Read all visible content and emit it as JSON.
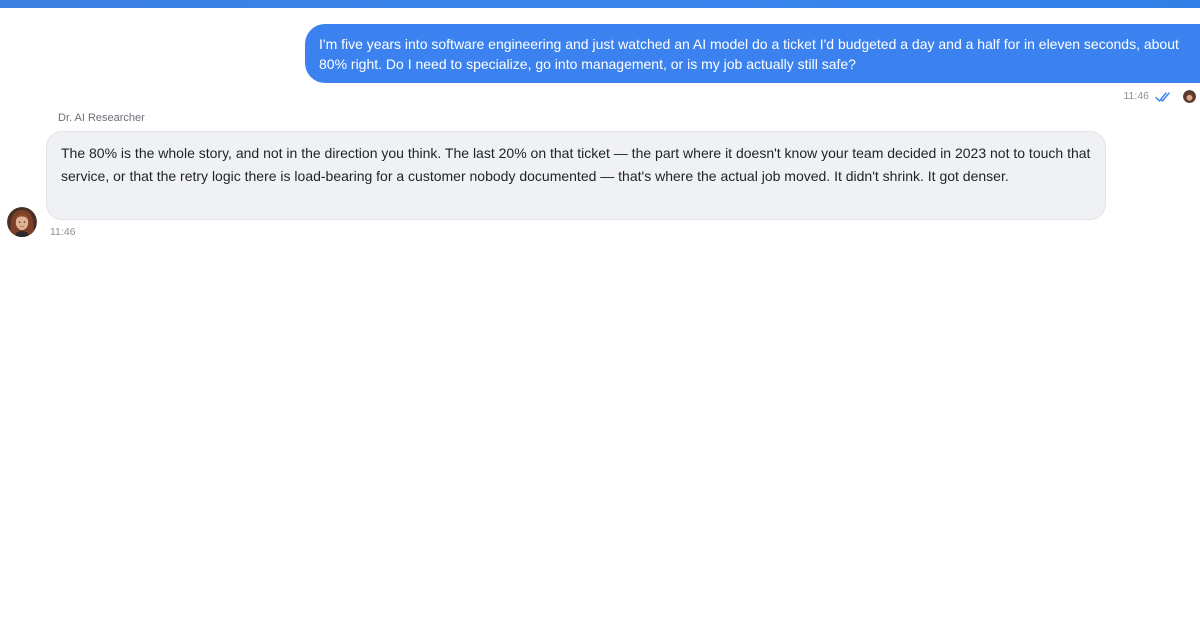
{
  "conversation": {
    "outgoing": {
      "text": "I'm five years into software engineering and just watched an AI model do a ticket I'd budgeted a day and a half for in eleven seconds, about 80% right. Do I need to specialize, go into management, or is my job actually still safe?",
      "time": "11:46",
      "status": "read",
      "bubble_color": "#3b82f0"
    },
    "incoming": {
      "sender": "Dr. AI Researcher",
      "text": "The 80% is the whole story, and not in the direction you think. The last 20% on that ticket — the part where it doesn't know your team decided in 2023 not to touch that service, or that the retry logic there is load-bearing for a customer nobody documented — that's where the actual job moved. It didn't shrink. It got denser.",
      "time": "11:46",
      "bubble_color": "#f0f1f4"
    }
  },
  "theme": {
    "accent": "#3b82f0",
    "receipt_color": "#3b82f0"
  }
}
